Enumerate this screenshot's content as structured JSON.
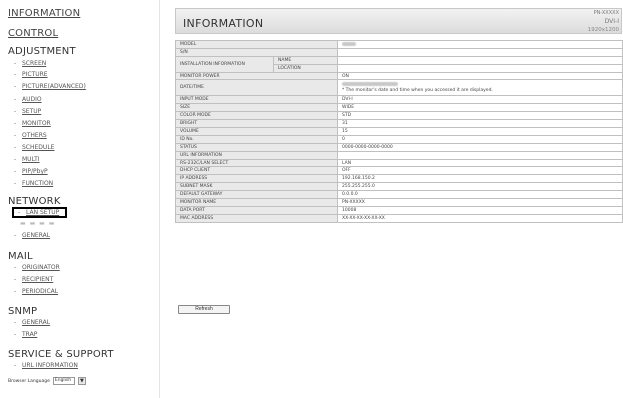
{
  "sidebar": {
    "information": "INFORMATION",
    "control": "CONTROL",
    "adjustment": {
      "title": "ADJUSTMENT",
      "items": [
        "SCREEN",
        "PICTURE",
        "PICTURE(ADVANCED)",
        "AUDIO",
        "SETUP",
        "MONITOR",
        "OTHERS",
        "SCHEDULE",
        "MULTI",
        "PIP/PbyP",
        "FUNCTION"
      ]
    },
    "network": {
      "title": "NETWORK",
      "items": [
        "LAN SETUP",
        "GENERAL"
      ]
    },
    "mail": {
      "title": "MAIL",
      "items": [
        "ORIGINATOR",
        "RECIPIENT",
        "PERIODICAL"
      ]
    },
    "snmp": {
      "title": "SNMP",
      "items": [
        "GENERAL",
        "TRAP"
      ]
    },
    "service": {
      "title": "SERVICE & SUPPORT",
      "items": [
        "URL INFORMATION"
      ]
    },
    "browser_language": {
      "label": "Browser Language",
      "value": "English",
      "arrow": "▼"
    }
  },
  "header": {
    "title": "INFORMATION",
    "model_code": "PN-XXXXX",
    "input_mode": "DVI-I",
    "resolution": "1920x1200"
  },
  "table": {
    "model": "MODEL",
    "sn": "S/N",
    "installation": "INSTALLATION INFORMATION",
    "name": "NAME",
    "location": "LOCATION",
    "monitor_power": "MONITOR POWER",
    "monitor_power_value": "ON",
    "date_time": "DATE/TIME",
    "date_time_note": "* The monitor's date and time when you accessed it are displayed.",
    "input_mode": "INPUT MODE",
    "input_mode_value": "DVI-I",
    "size": "SIZE",
    "size_value": "WIDE",
    "color_mode": "COLOR MODE",
    "color_mode_value": "STD",
    "bright": "BRIGHT",
    "bright_value": "31",
    "volume": "VOLUME",
    "volume_value": "15",
    "id_no": "ID No.",
    "id_no_value": "0",
    "status": "STATUS",
    "status_value": "0000-0000-0000-0000",
    "url_information": "URL INFORMATION",
    "rs232c": "RS-232C/LAN SELECT",
    "rs232c_value": "LAN",
    "dhcp": "DHCP CLIENT",
    "dhcp_value": "OFF",
    "ip": "IP ADDRESS",
    "ip_value": "192.168.150.2",
    "subnet": "SUBNET MASK",
    "subnet_value": "255.255.255.0",
    "gateway": "DEFAULT GATEWAY",
    "gateway_value": "0.0.0.0",
    "monitor_name": "MONITOR NAME",
    "monitor_name_value": "PN-XXXXX",
    "data_port": "DATA PORT",
    "data_port_value": "10008",
    "mac": "MAC ADDRESS",
    "mac_value": "XX-XX-XX-XX-XX-XX"
  },
  "refresh_label": "Refresh",
  "colors": {
    "label_cell": "#e9e9e9",
    "border": "#c0c0c0",
    "highlight_box": "#000000"
  }
}
